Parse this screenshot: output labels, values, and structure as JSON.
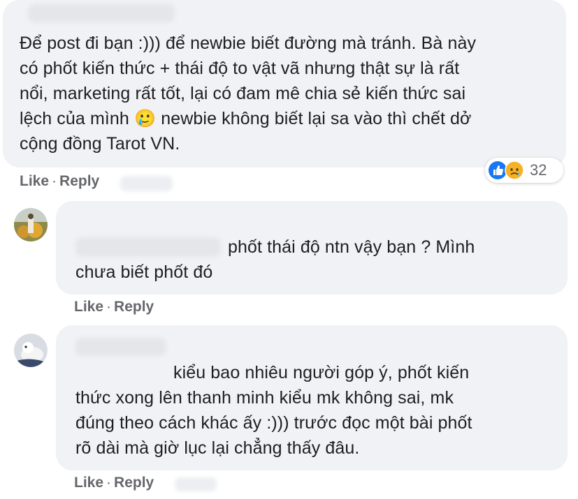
{
  "comments": [
    {
      "text": "Để post đi bạn :))) để newbie biết đường mà tránh. Bà này\ncó phốt kiến thức + thái độ to vật vã nhưng thật sự là rất\nnổi, marketing rất tốt, lại có đam mê chia sẻ kiến thức sai\nlệch của mình 🥲 newbie không biết lại sa vào thì chết dở\ncộng đồng Tarot VN.",
      "like_label": "Like",
      "reply_label": "Reply",
      "separator": "·",
      "reaction_count": "32",
      "reactions": [
        "like-icon",
        "sad-icon"
      ]
    },
    {
      "text": "phốt thái độ ntn vậy bạn ? Mình\nchưa biết phốt đó",
      "like_label": "Like",
      "reply_label": "Reply",
      "separator": "·"
    },
    {
      "text": "kiểu bao nhiêu người góp ý, phốt kiến\nthức xong lên thanh minh kiểu mk không sai, mk\nđúng theo cách khác ấy :))) trước đọc một bài phốt\nrõ dài mà giờ lục lại chẳng thấy đâu.",
      "like_label": "Like",
      "reply_label": "Reply",
      "separator": "·"
    }
  ],
  "colors": {
    "bubble": "#f0f2f5",
    "action_text": "#65676b",
    "like_blue": "#1877f2",
    "sad_yellow": "#f7b125"
  }
}
